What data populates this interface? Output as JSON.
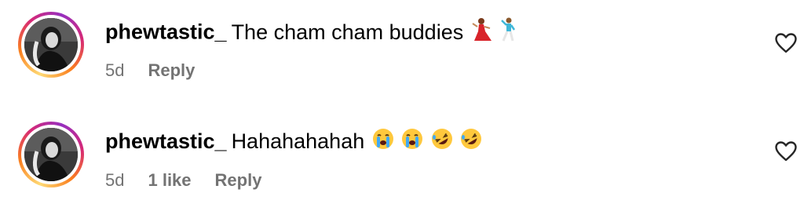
{
  "comments": [
    {
      "username": "phewtastic_",
      "text": "The cham cham buddies",
      "emojis": [
        "dancer-emoji",
        "man-dancing-emoji"
      ],
      "age": "5d",
      "likes": "",
      "reply_label": "Reply"
    },
    {
      "username": "phewtastic_",
      "text": "Hahahahahah",
      "emojis": [
        "loudly-crying-face-emoji",
        "loudly-crying-face-emoji",
        "rolling-on-floor-laughing-emoji",
        "rolling-on-floor-laughing-emoji"
      ],
      "age": "5d",
      "likes": "1 like",
      "reply_label": "Reply"
    }
  ],
  "colors": {
    "meta_gray": "#737373",
    "story_ring": [
      "#feda75",
      "#fa7e1e",
      "#d62976",
      "#962fbf"
    ]
  }
}
